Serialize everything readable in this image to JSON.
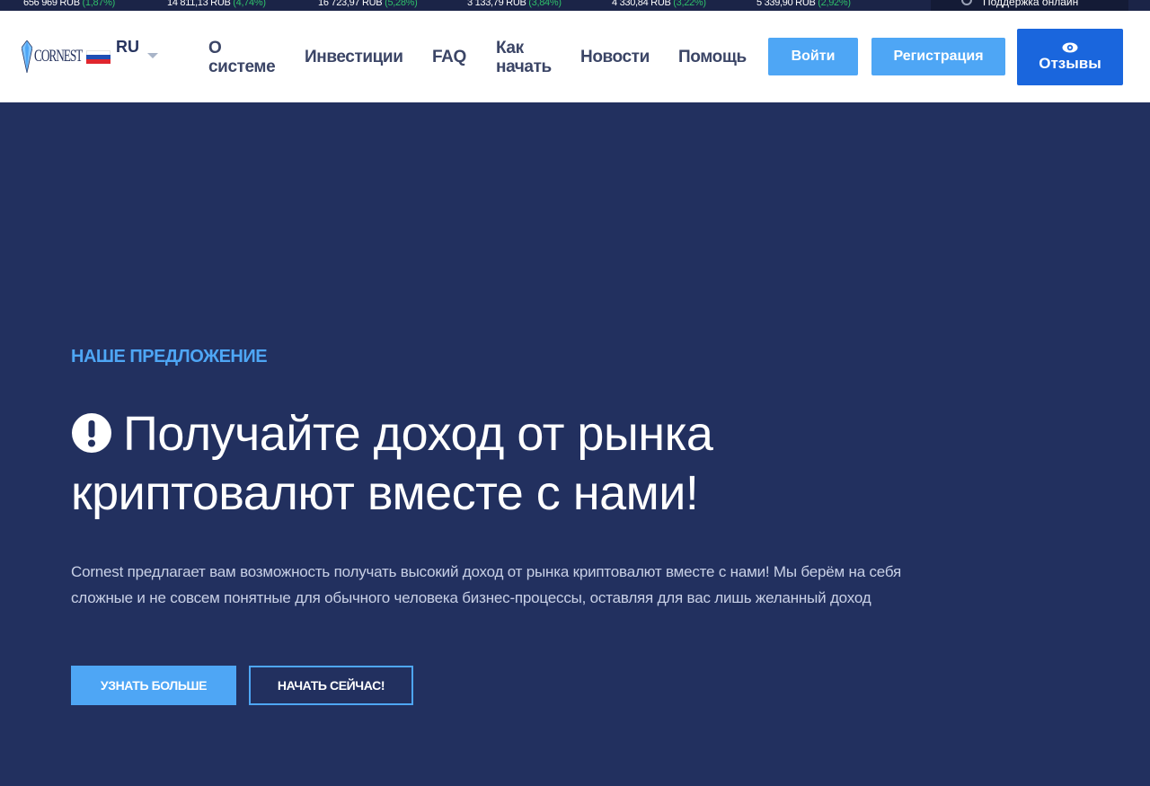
{
  "ticker": {
    "items": [
      {
        "price": "656 969 RUB",
        "change": "(1,87%)"
      },
      {
        "price": "14 811,13 RUB",
        "change": "(4,74%)"
      },
      {
        "price": "16 723,97 RUB",
        "change": "(5,28%)"
      },
      {
        "price": "3 133,79 RUB",
        "change": "(3,84%)"
      },
      {
        "price": "4 330,84 RUB",
        "change": "(3,22%)"
      },
      {
        "price": "5 339,90 RUB",
        "change": "(2,92%)"
      }
    ],
    "support_label": "Поддержка онлайн"
  },
  "header": {
    "logo_text": "CORNEST",
    "language": "RU",
    "nav": [
      {
        "line1": "О",
        "line2": "системе"
      },
      {
        "line1": "Инвестиции",
        "line2": ""
      },
      {
        "line1": "FAQ",
        "line2": ""
      },
      {
        "line1": "Как",
        "line2": "начать"
      },
      {
        "line1": "Новости",
        "line2": ""
      },
      {
        "line1": "Помощь",
        "line2": ""
      }
    ],
    "login_label": "Войти",
    "register_label": "Регистрация",
    "reviews_label": "Отзывы"
  },
  "hero": {
    "kicker": "НАШЕ ПРЕДЛОЖЕНИЕ",
    "headline_line1": "Получайте доход от рынка",
    "headline_line2": "криптовалют вместе с нами!",
    "description_line1": "Cornest предлагает вам возможность получать высокий доход от рынка криптовалют вместе с нами! Мы берём на себя",
    "description_line2": "сложные и не совсем понятные для обычного человека бизнес-процессы, оставляя для вас лишь желанный доход",
    "learn_more_label": "УЗНАТЬ БОЛЬШЕ",
    "start_now_label": "НАЧАТЬ СЕЙЧАС!"
  },
  "colors": {
    "hero_background": "#22305f",
    "accent_blue": "#4ea6f5",
    "reviews_button": "#1a66dd",
    "ticker_change_green": "#2fbf6a"
  },
  "icons": [
    "gem-logo-icon",
    "ru-flag-icon",
    "chevron-down-icon",
    "eye-icon",
    "exclamation-circle-icon",
    "support-icon"
  ]
}
